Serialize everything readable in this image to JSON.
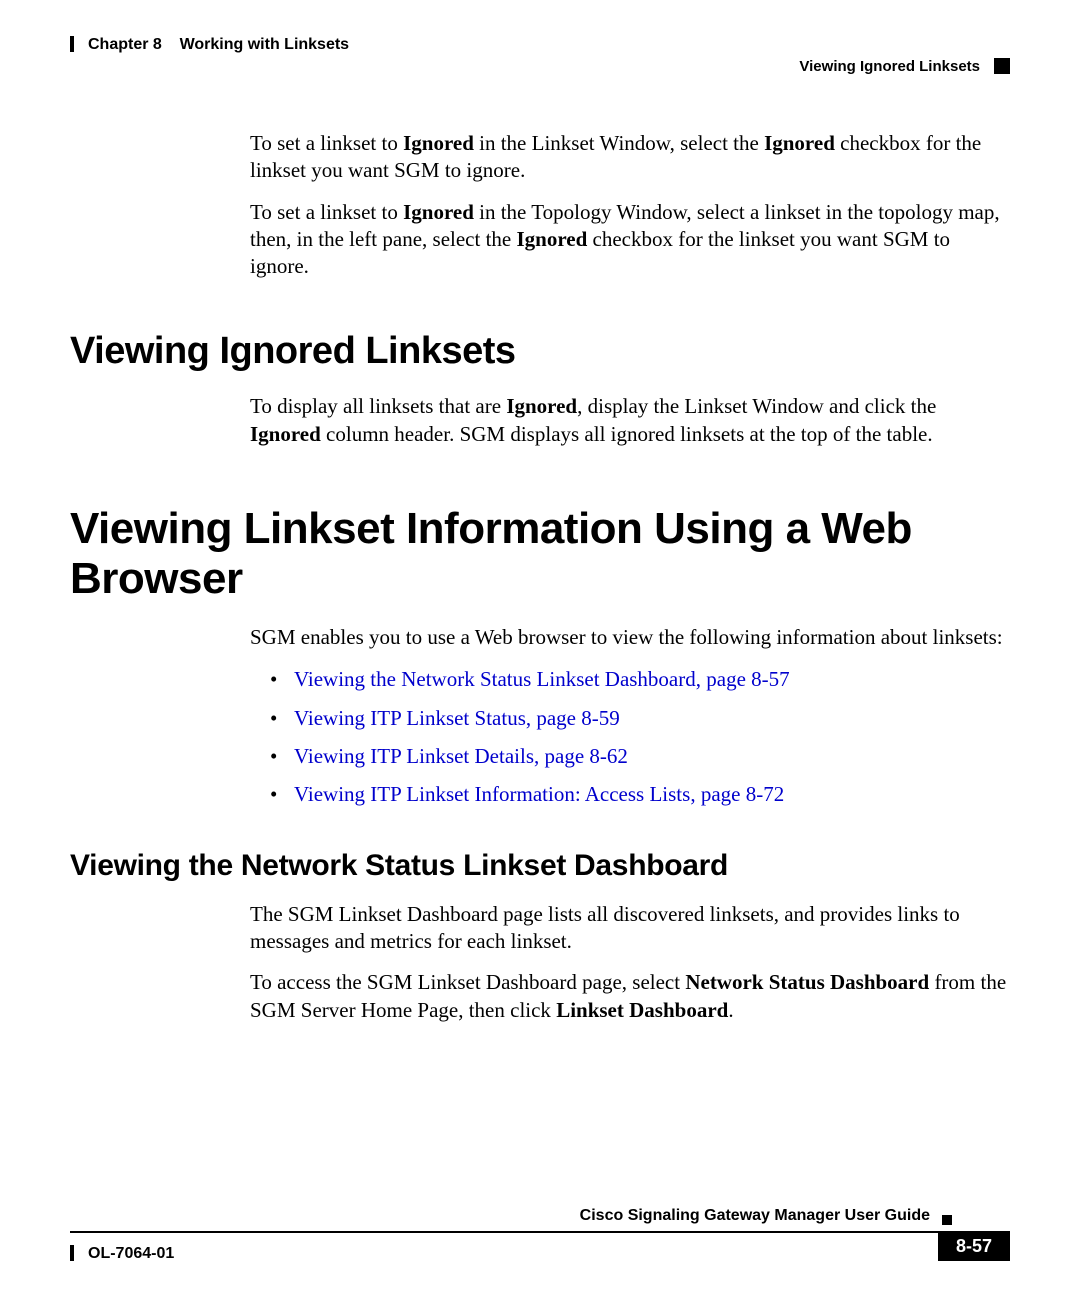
{
  "header": {
    "chapter_label": "Chapter 8",
    "chapter_title": "Working with Linksets",
    "section_title": "Viewing Ignored Linksets"
  },
  "intro": {
    "p1_pre": "To set a linkset to ",
    "p1_b1": "Ignored",
    "p1_mid": " in the Linkset Window, select the ",
    "p1_b2": "Ignored",
    "p1_post": " checkbox for the linkset you want SGM to ignore.",
    "p2_pre": "To set a linkset to ",
    "p2_b1": "Ignored",
    "p2_mid": " in the Topology Window, select a linkset in the topology map, then, in the left pane, select the ",
    "p2_b2": "Ignored",
    "p2_post": " checkbox for the linkset you want SGM to ignore."
  },
  "sec1": {
    "title": "Viewing Ignored Linksets",
    "p1_pre": "To display all linksets that are ",
    "p1_b1": "Ignored",
    "p1_mid": ", display the Linkset Window and click the ",
    "p1_b2": "Ignored",
    "p1_post": " column header. SGM displays all ignored linksets at the top of the table."
  },
  "sec2": {
    "title": "Viewing Linkset Information Using a Web Browser",
    "p1": "SGM enables you to use a Web browser to view the following information about linksets:",
    "links": {
      "l1": "Viewing the Network Status Linkset Dashboard, page 8-57",
      "l2": "Viewing ITP Linkset Status, page 8-59",
      "l3": "Viewing ITP Linkset Details, page 8-62",
      "l4": "Viewing ITP Linkset Information: Access Lists, page 8-72"
    }
  },
  "sec3": {
    "title": "Viewing the Network Status Linkset Dashboard",
    "p1": "The SGM Linkset Dashboard page lists all discovered linksets, and provides links to messages and metrics for each linkset.",
    "p2_pre": "To access the SGM Linkset Dashboard page, select ",
    "p2_b1": "Network Status Dashboard",
    "p2_mid": " from the SGM Server Home Page, then click ",
    "p2_b2": "Linkset Dashboard",
    "p2_post": "."
  },
  "footer": {
    "guide_title": "Cisco Signaling Gateway Manager User Guide",
    "doc_id": "OL-7064-01",
    "page_num": "8-57"
  }
}
